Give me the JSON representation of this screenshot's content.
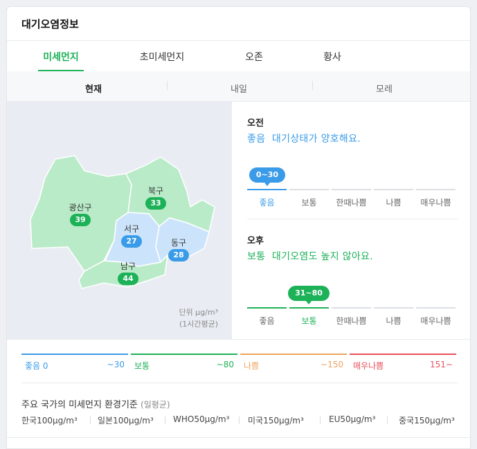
{
  "title": "대기오염정보",
  "tabs": [
    "미세먼지",
    "초미세먼지",
    "오존",
    "황사"
  ],
  "subtabs": [
    "현재",
    "내일",
    "모레"
  ],
  "districts": [
    {
      "name": "광산구",
      "value": "39",
      "color": "#1db158"
    },
    {
      "name": "북구",
      "value": "33",
      "color": "#1db158"
    },
    {
      "name": "서구",
      "value": "27",
      "color": "#3a9be8"
    },
    {
      "name": "동구",
      "value": "28",
      "color": "#3a9be8"
    },
    {
      "name": "남구",
      "value": "44",
      "color": "#1db158"
    }
  ],
  "unit": {
    "line1": "단위 μg/m³",
    "line2": "(1시간평균)"
  },
  "morning": {
    "label": "오전",
    "grade": "좋음",
    "message": "대기상태가 양호해요.",
    "color": "#3a9be8",
    "range": "0~30",
    "active_index": 0
  },
  "afternoon": {
    "label": "오후",
    "grade": "보통",
    "message": "대기오염도 높지 않아요.",
    "color": "#1db158",
    "range": "31~80",
    "active_index": 1
  },
  "scale_labels": [
    "좋음",
    "보통",
    "한때나쁨",
    "나쁨",
    "매우나쁨"
  ],
  "legend": [
    {
      "name": "좋음 0",
      "range": "~30",
      "color": "#3a9be8"
    },
    {
      "name": "보통",
      "range": "~80",
      "color": "#1db158"
    },
    {
      "name": "나쁨",
      "range": "~150",
      "color": "#f0a35e"
    },
    {
      "name": "매우나쁨",
      "range": "151~",
      "color": "#e8505b"
    }
  ],
  "standards": {
    "title": "주요 국가의 미세먼지 환경기준",
    "subtitle": "(일평균)",
    "items": [
      "한국100μg/m³",
      "일본100μg/m³",
      "WHO50μg/m³",
      "미국150μg/m³",
      "EU50μg/m³",
      "중국150μg/m³"
    ]
  }
}
